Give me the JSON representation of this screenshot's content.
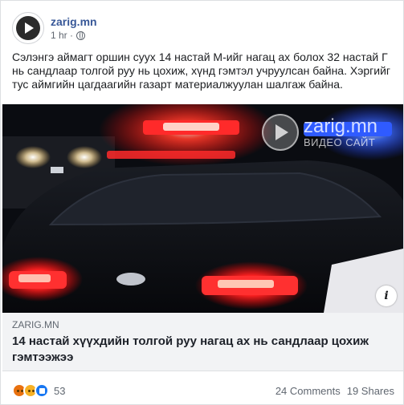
{
  "post": {
    "page_name": "zarig.mn",
    "time": "1 hr ·",
    "privacy_icon": "globe-icon",
    "text": "Сэлэнгэ аймагт оршин суух 14 настай М-ийг нагац ах болох 32 настай Г нь сандлаар толгой руу нь цохиж, хүнд гэмтэл учруулсан байна. Хэргийг тус аймгийн цагдаагийн газарт материалжуулан шалгаж байна."
  },
  "image": {
    "watermark_name": "zarig.mn",
    "watermark_sub": "ВИДЕО САЙТ",
    "info_label": "i"
  },
  "link": {
    "domain": "ZARIG.MN",
    "title": "14 настай хүүхдийн толгой руу нагац ах нь сандлаар цохиж гэмтээжээ"
  },
  "footer": {
    "reaction_icons": [
      "angry-icon",
      "sad-icon",
      "like-icon"
    ],
    "reaction_count": "53",
    "comments": "24 Comments",
    "shares": "19 Shares"
  },
  "colors": {
    "page_name": "#385898",
    "secondary_text": "#606770",
    "link_bg": "#f2f3f5",
    "police_red": "#ff2a2a",
    "police_blue": "#2f5bff"
  }
}
